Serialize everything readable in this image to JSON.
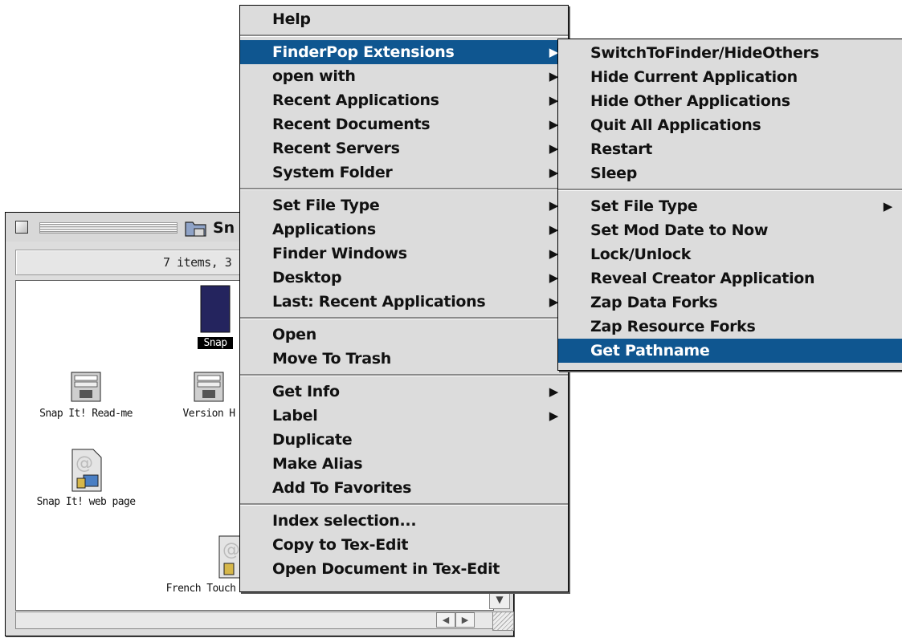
{
  "finder_window": {
    "title": "Sn",
    "info": "7 items, 3",
    "items": [
      {
        "label": "Snap"
      },
      {
        "label": "Snap It! Read-me"
      },
      {
        "label": "Version H"
      },
      {
        "label": "Snap It! web page"
      },
      {
        "label": "French Touch"
      }
    ],
    "scroll_left": "◀",
    "scroll_right": "▶",
    "scroll_down": "▼"
  },
  "context_menu": {
    "group1": [
      {
        "label": "Help"
      }
    ],
    "group2": [
      {
        "label": "FinderPop Extensions",
        "arrow": "▶"
      },
      {
        "label": "open with",
        "arrow": "▶"
      },
      {
        "label": "Recent Applications",
        "arrow": "▶"
      },
      {
        "label": "Recent Documents",
        "arrow": "▶"
      },
      {
        "label": "Recent Servers",
        "arrow": "▶"
      },
      {
        "label": "System Folder",
        "arrow": "▶"
      }
    ],
    "group3": [
      {
        "label": "Set File Type",
        "arrow": "▶"
      },
      {
        "label": "Applications",
        "arrow": "▶"
      },
      {
        "label": "Finder Windows",
        "arrow": "▶"
      },
      {
        "label": "Desktop",
        "arrow": "▶"
      },
      {
        "label": "Last: Recent Applications",
        "arrow": "▶"
      }
    ],
    "group4": [
      {
        "label": "Open"
      },
      {
        "label": "Move To Trash"
      }
    ],
    "group5": [
      {
        "label": "Get Info",
        "arrow": "▶"
      },
      {
        "label": "Label",
        "arrow": "▶"
      },
      {
        "label": "Duplicate"
      },
      {
        "label": "Make Alias"
      },
      {
        "label": "Add To Favorites"
      }
    ],
    "group6": [
      {
        "label": "Index selection..."
      },
      {
        "label": "Copy to Tex-Edit"
      },
      {
        "label": "Open Document in Tex-Edit"
      }
    ]
  },
  "submenu": {
    "group1": [
      {
        "label": "SwitchToFinder/HideOthers"
      },
      {
        "label": "Hide Current Application"
      },
      {
        "label": "Hide Other Applications"
      },
      {
        "label": "Quit All Applications"
      },
      {
        "label": "Restart"
      },
      {
        "label": "Sleep"
      }
    ],
    "group2": [
      {
        "label": "Set File Type",
        "arrow": "▶"
      },
      {
        "label": "Set Mod Date to Now"
      },
      {
        "label": "Lock/Unlock"
      },
      {
        "label": "Reveal Creator Application"
      },
      {
        "label": "Zap Data Forks"
      },
      {
        "label": "Zap Resource Forks"
      },
      {
        "label": "Get Pathname"
      }
    ]
  },
  "colors": {
    "highlight": "#0f5690",
    "menu_bg": "#dcdcdc",
    "folder_icon": "#2a2a6a"
  }
}
